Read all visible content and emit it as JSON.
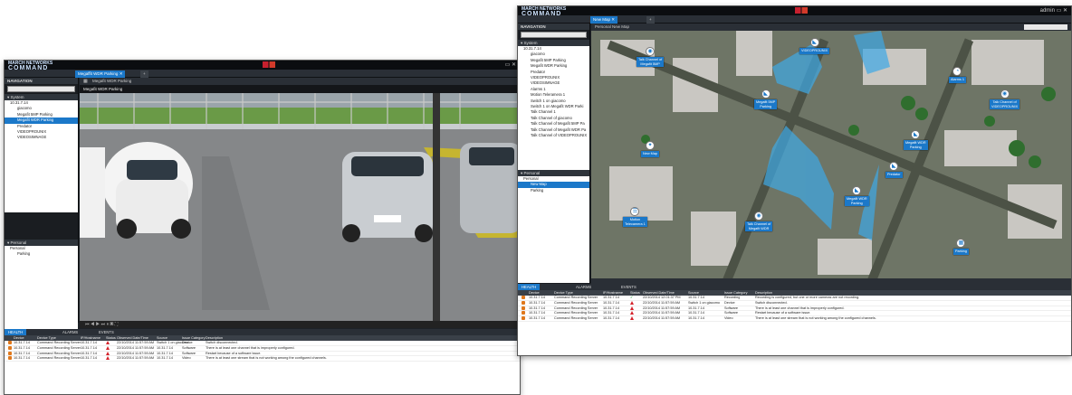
{
  "window1": {
    "logo_line1": "MARCH NETWORKS",
    "logo_line2": "COMMAND",
    "logo_line3": "Professional",
    "tab_active": "Megaffit WDR Parking",
    "nav_title": "NAVIGATION",
    "system_section": "System",
    "tree": [
      "10.31.7.14",
      "giacomo",
      "Megafit 5MP Parking",
      "Megafit WDR Parking",
      "Predator",
      "VIDEOPROUNIX",
      "VIDEOSIMNAGE"
    ],
    "tree_selected": 3,
    "personal_section": "Personal",
    "personal_tree": [
      "Personal",
      "Parking"
    ],
    "camera_title": "Megafit WDR Parking",
    "health_tab": "HEALTH",
    "alarms_tab": "ALARMS",
    "events_tab": "EVENTS",
    "grid_headers": [
      "Device",
      "Device Type",
      "IP/Hostname",
      "Status",
      "Observed Date/Time",
      "Source",
      "Issue Category",
      "Description"
    ],
    "rows": [
      {
        "device": "10.31.7.14",
        "type": "Command Recording Server",
        "ip": "10.31.7.14",
        "status": "warn",
        "time": "22/10/2014 11:57:59 AM",
        "source": "Switch 1 on giacomo",
        "cat": "Device",
        "desc": "Switch disconnected."
      },
      {
        "device": "10.31.7.14",
        "type": "Command Recording Server",
        "ip": "10.31.7.14",
        "status": "warn",
        "time": "22/10/2014 11:57:59 AM",
        "source": "10.31.7.14",
        "cat": "Software",
        "desc": "There is at least one channel that is improperly configured."
      },
      {
        "device": "10.31.7.14",
        "type": "Command Recording Server",
        "ip": "10.31.7.14",
        "status": "warn",
        "time": "22/10/2014 11:57:59 AM",
        "source": "10.31.7.14",
        "cat": "Software",
        "desc": "Restart because of a software issue."
      },
      {
        "device": "10.31.7.14",
        "type": "Command Recording Server",
        "ip": "10.31.7.14",
        "status": "warn",
        "time": "22/10/2014 11:57:59 AM",
        "source": "10.31.7.14",
        "cat": "Video",
        "desc": "There is at least one stream that is not working among the configured channels."
      }
    ]
  },
  "window2": {
    "tab_active": "New Map",
    "user": "admin",
    "nav_title": "NAVIGATION",
    "breadcrumb": [
      "Personal",
      "New Map"
    ],
    "system_section": "System",
    "tree": [
      "10.31.7.14",
      "giacomo",
      "Megafit 5MP Parking",
      "Megafit WDR Parking",
      "Predator",
      "VIDEOPROUNIX",
      "VIDEOSIMNAGE",
      "Alarms 1",
      "Motion Teleramera 1",
      "Switch 1 on giacomo",
      "Switch 1 on Megafit WDR Parki",
      "Talk Channel 1",
      "Talk Channel of giacomo",
      "Talk Channel of Megafit 5MP Pa",
      "Talk Channel of Megafit WDR Pa",
      "Talk Channel of VIDEOPROUNIX"
    ],
    "personal_section": "Personal",
    "personal_tree": [
      "Personal",
      "New Map",
      "Parking"
    ],
    "personal_selected": 1,
    "markers": [
      {
        "label": "Talk Channel of\nMegafit 5MP",
        "icon": "speaker-icon"
      },
      {
        "label": "VIDEOPROUNIX",
        "icon": "camera-icon"
      },
      {
        "label": "Megafit 5MP\nParking",
        "icon": "camera-icon"
      },
      {
        "label": "Alarms 1",
        "icon": "alarm-icon"
      },
      {
        "label": "Talk Channel of\nVIDEOPROUNIX",
        "icon": "speaker-icon"
      },
      {
        "label": "New Map",
        "icon": "map-icon"
      },
      {
        "label": "Megafit WDR\nParking",
        "icon": "camera-icon"
      },
      {
        "label": "Predator",
        "icon": "camera-icon"
      },
      {
        "label": "Megafit WDR\nParking",
        "icon": "camera-icon"
      },
      {
        "label": "Motion\nTelecamera 1",
        "icon": "motion-icon"
      },
      {
        "label": "Talk Channel of\nMegafit WDR",
        "icon": "speaker-icon"
      },
      {
        "label": "Parking",
        "icon": "grid-icon"
      }
    ],
    "health_tab": "HEALTH",
    "alarms_tab": "ALARMS",
    "events_tab": "EVENTS",
    "grid_headers": [
      "Device",
      "Device Type",
      "IP/Hostname",
      "Status",
      "Observed Date/Time",
      "Source",
      "Issue Category",
      "Description"
    ],
    "rows": [
      {
        "device": "10.31.7.14",
        "type": "Command Recording Server",
        "ip": "10.31.7.14",
        "status": "ok",
        "time": "22/10/2014 12:01:37 PM",
        "source": "10.31.7.14",
        "cat": "Recording",
        "desc": "Recording is configured, but one or more cameras are not recording."
      },
      {
        "device": "10.31.7.14",
        "type": "Command Recording Server",
        "ip": "10.31.7.14",
        "status": "warn",
        "time": "22/10/2014 11:57:59 AM",
        "source": "Switch 1 on giacomo",
        "cat": "Device",
        "desc": "Switch disconnected."
      },
      {
        "device": "10.31.7.14",
        "type": "Command Recording Server",
        "ip": "10.31.7.14",
        "status": "warn",
        "time": "22/10/2014 11:57:59 AM",
        "source": "10.31.7.14",
        "cat": "Software",
        "desc": "There is at least one channel that is improperly configured."
      },
      {
        "device": "10.31.7.14",
        "type": "Command Recording Server",
        "ip": "10.31.7.14",
        "status": "warn",
        "time": "22/10/2014 11:57:59 AM",
        "source": "10.31.7.14",
        "cat": "Software",
        "desc": "Restart because of a software issue."
      },
      {
        "device": "10.31.7.14",
        "type": "Command Recording Server",
        "ip": "10.31.7.14",
        "status": "warn",
        "time": "22/10/2014 11:57:59 AM",
        "source": "10.31.7.14",
        "cat": "Video",
        "desc": "There is at least one stream that is not working among the configured channels."
      }
    ]
  },
  "colors": {
    "accent": "#1b78c9",
    "coverage": "#3fa9e6",
    "warn": "#d4212a",
    "record": "#e0781c"
  }
}
